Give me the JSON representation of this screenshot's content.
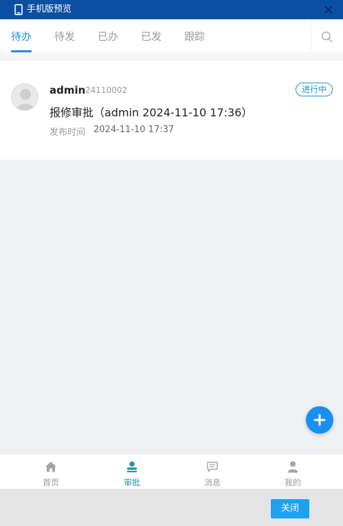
{
  "window": {
    "title": "手机版预览",
    "icons": {
      "device": "phone-icon",
      "close": "close-icon"
    }
  },
  "tabs": [
    {
      "label": "待办",
      "active": true
    },
    {
      "label": "待发",
      "active": false
    },
    {
      "label": "已办",
      "active": false
    },
    {
      "label": "已发",
      "active": false
    },
    {
      "label": "跟踪",
      "active": false
    }
  ],
  "search": {
    "icon": "search-icon"
  },
  "list": [
    {
      "username": "admin",
      "user_id": "24110002",
      "status": "进行中",
      "title": "报修审批（admin 2024-11-10 17:36）",
      "meta_label": "发布时间",
      "meta_value": "2024-11-10 17:37",
      "avatar_icon": "avatar-placeholder"
    }
  ],
  "fab": {
    "icon": "plus-icon"
  },
  "bottom_nav": [
    {
      "label": "首页",
      "icon": "home-icon",
      "active": false
    },
    {
      "label": "审批",
      "icon": "approval-icon",
      "active": true
    },
    {
      "label": "消息",
      "icon": "message-icon",
      "active": false
    },
    {
      "label": "我的",
      "icon": "user-icon",
      "active": false
    }
  ],
  "footer": {
    "close_label": "关闭"
  },
  "colors": {
    "titlebar": "#0b4fa3",
    "accent": "#1f8fd6",
    "nav_active": "#2693a8",
    "fab": "#1b8ff0",
    "close_button": "#1fa1ee"
  }
}
